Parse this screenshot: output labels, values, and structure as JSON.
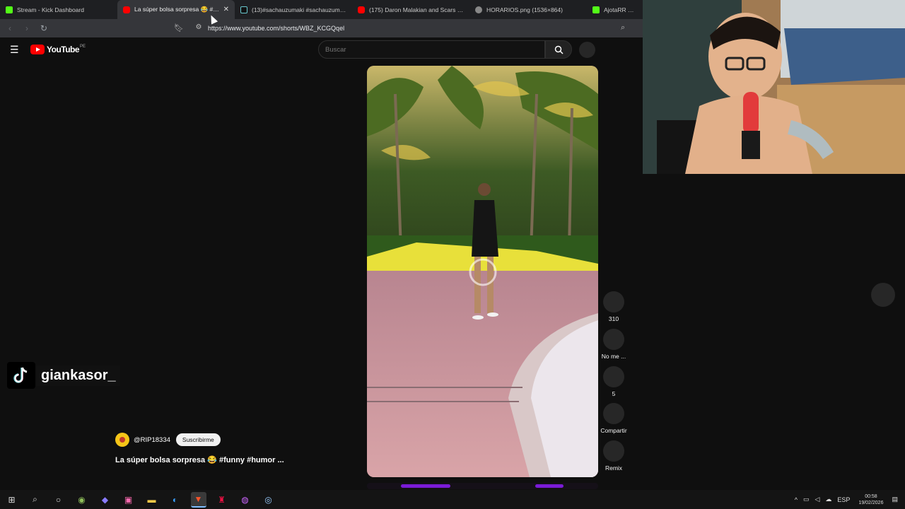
{
  "browser": {
    "tabs": [
      {
        "title": "Stream - Kick Dashboard",
        "favicon": "kick-icon",
        "active": false
      },
      {
        "title": "La súper bolsa sorpresa 😂 #funny",
        "favicon": "youtube-icon",
        "active": true
      },
      {
        "title": "(13)#sachauzumaki #sachauzumakicl",
        "favicon": "tiktok-icon",
        "active": false
      },
      {
        "title": "(175) Daron Malakian and Scars On B",
        "favicon": "youtube-icon",
        "active": false
      },
      {
        "title": "HORARIOS.png (1536×864)",
        "favicon": "image-icon",
        "active": false
      },
      {
        "title": "AjotaRR Stream -",
        "favicon": "kick-icon",
        "active": false
      }
    ],
    "url": "https://www.youtube.com/shorts/WBZ_KCGQqel"
  },
  "youtube": {
    "logo_text": "YouTube",
    "country_code": "PE",
    "search_placeholder": "Buscar"
  },
  "short": {
    "actions": [
      {
        "icon": "like-icon",
        "label": "310"
      },
      {
        "icon": "dislike-icon",
        "label": "No me ..."
      },
      {
        "icon": "comment-icon",
        "label": "5"
      },
      {
        "icon": "share-icon",
        "label": "Compartir"
      },
      {
        "icon": "remix-icon",
        "label": "Remix"
      }
    ],
    "channel": "@RIP18334",
    "subscribe_label": "Suscribirme",
    "title": "La súper bolsa sorpresa 😂 #funny #humor ..."
  },
  "overlay": {
    "tiktok_handle": "giankasor_"
  },
  "taskbar": {
    "language": "ESP",
    "time": "00:58",
    "date": "19/02/2026"
  },
  "colors": {
    "youtube_red": "#ff0000",
    "kick_green": "#53fc18",
    "page_bg": "#0f0f0f"
  }
}
